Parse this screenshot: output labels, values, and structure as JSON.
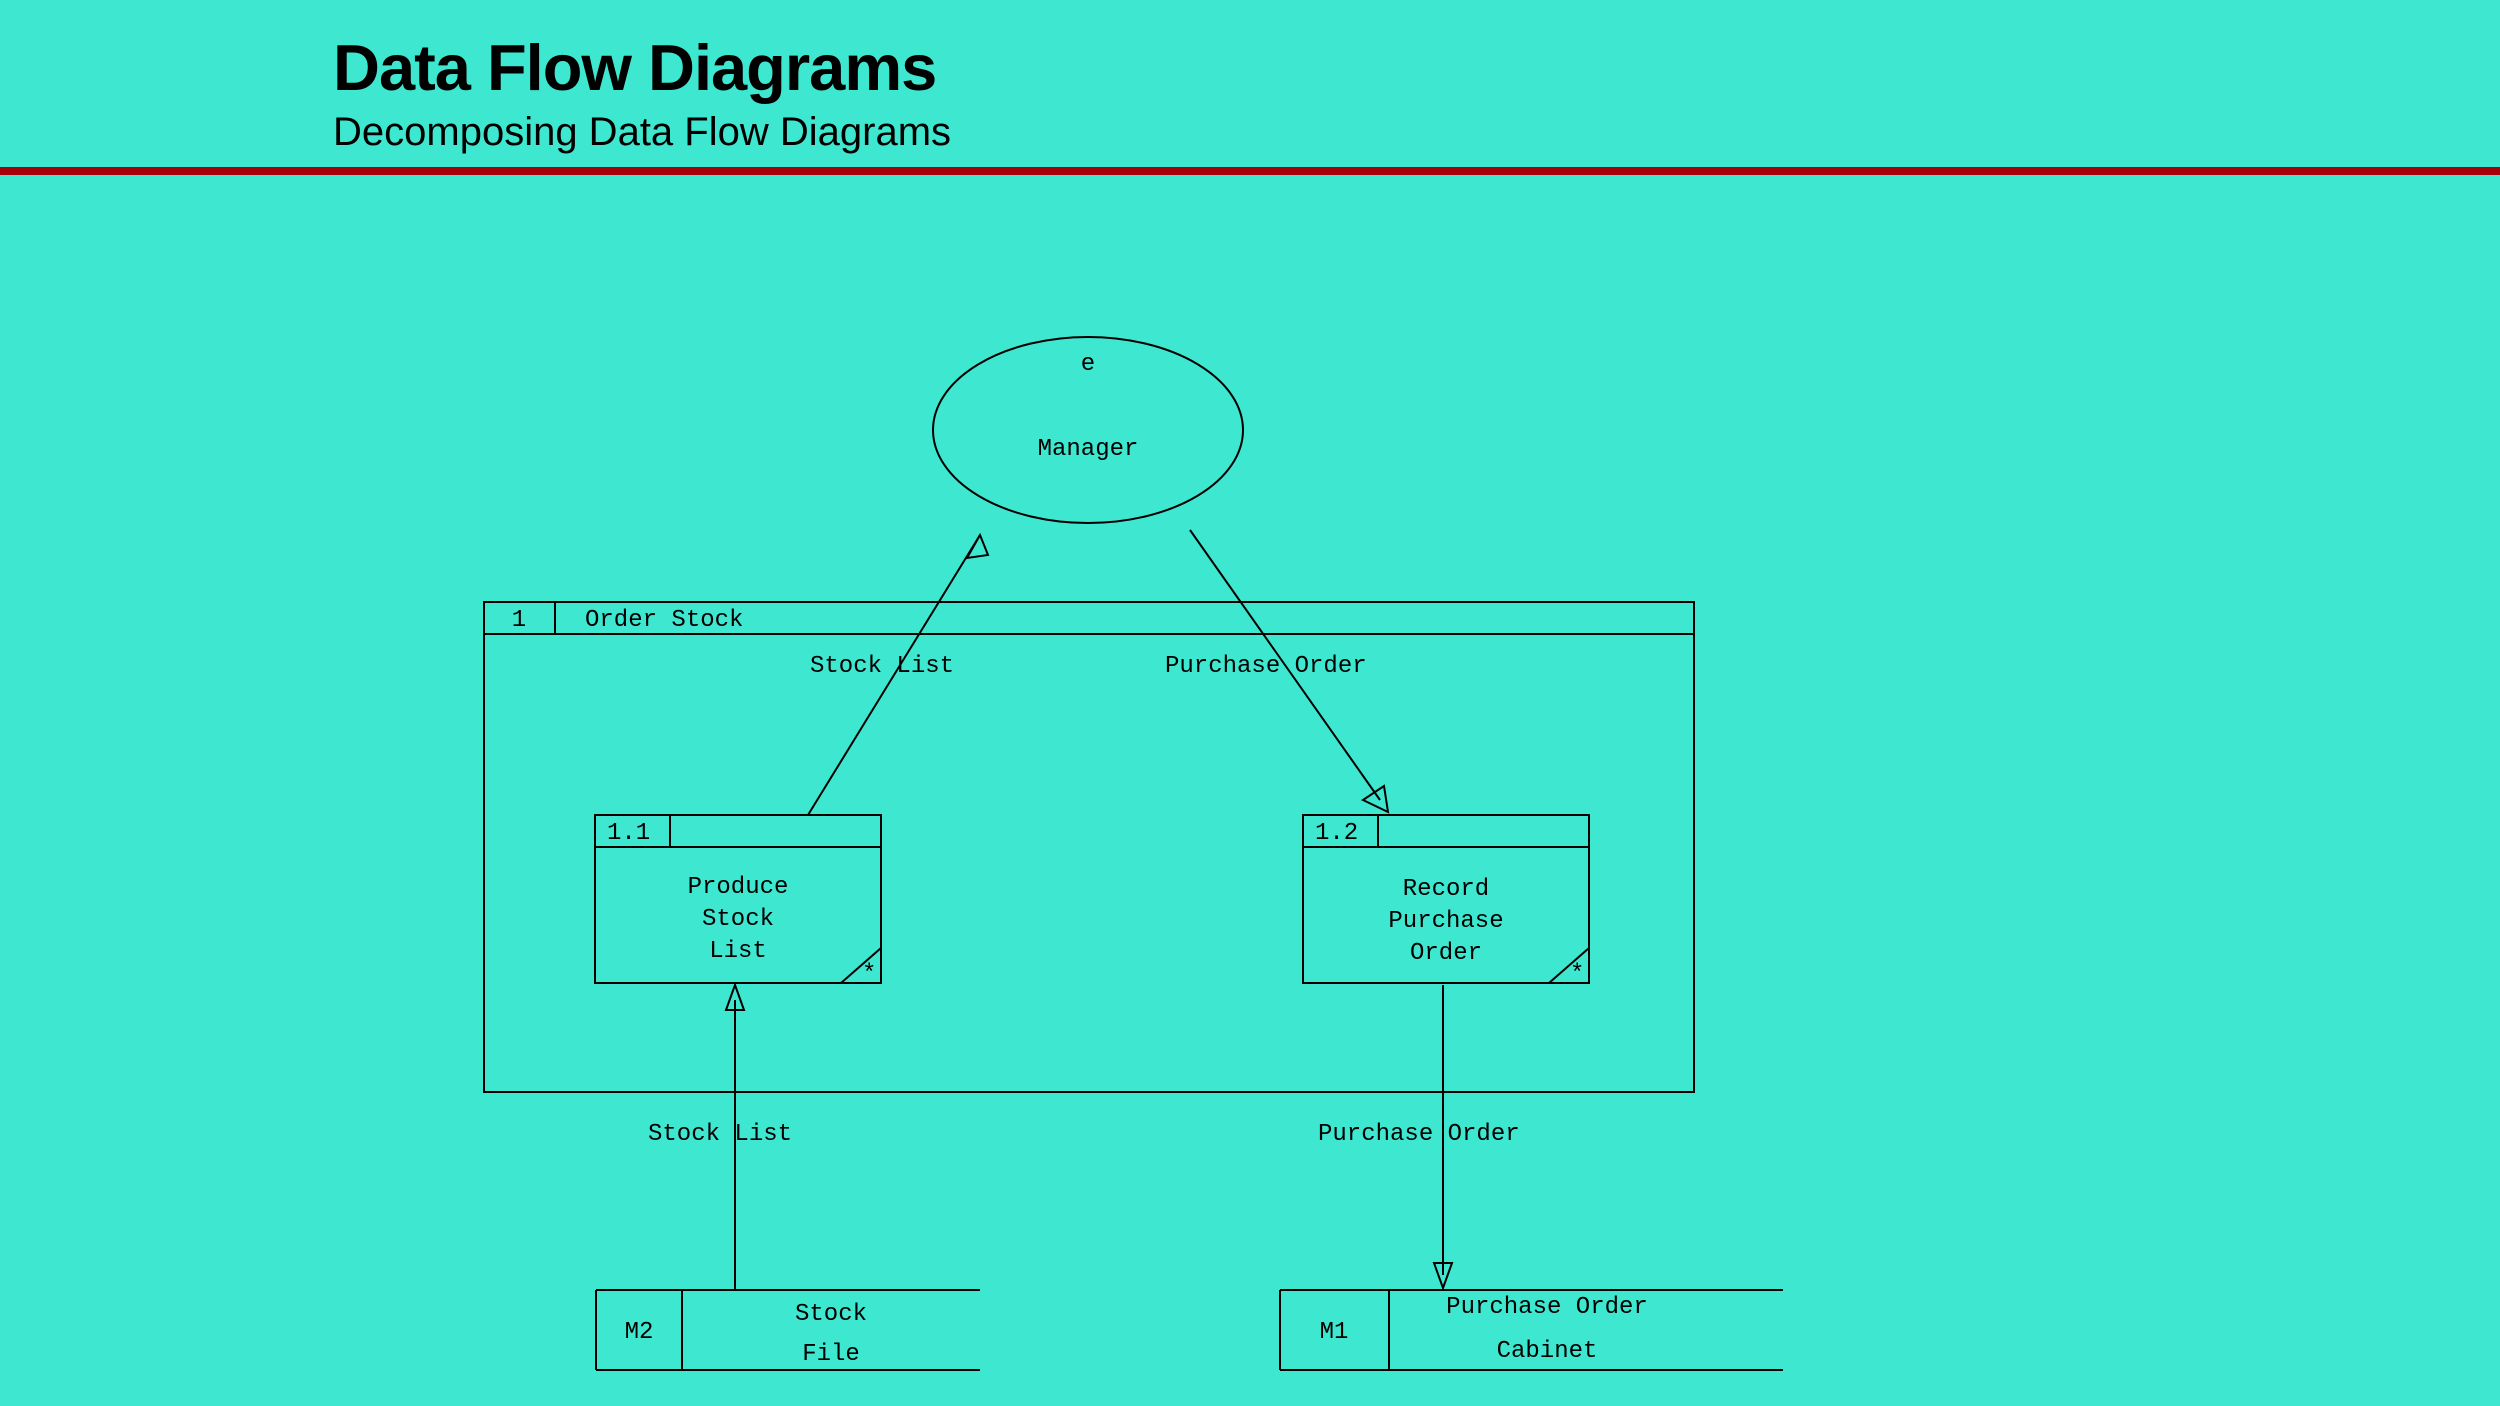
{
  "header": {
    "title": "Data Flow Diagrams",
    "subtitle": "Decomposing Data Flow Diagrams"
  },
  "external": {
    "tag": "e",
    "name": "Manager"
  },
  "container": {
    "id": "1",
    "title": "Order Stock"
  },
  "processes": {
    "p11": {
      "id": "1.1",
      "line1": "Produce",
      "line2": "Stock",
      "line3": "List",
      "marker": "*"
    },
    "p12": {
      "id": "1.2",
      "line1": "Record",
      "line2": "Purchase",
      "line3": "Order",
      "marker": "*"
    }
  },
  "flows": {
    "stockList": "Stock List",
    "purchaseOrder": "Purchase Order",
    "stockList2": "Stock List",
    "purchaseOrder2": "Purchase Order"
  },
  "datastores": {
    "m2": {
      "id": "M2",
      "line1": "Stock",
      "line2": "File"
    },
    "m1": {
      "id": "M1",
      "line1": "Purchase Order",
      "line2": "Cabinet"
    }
  }
}
